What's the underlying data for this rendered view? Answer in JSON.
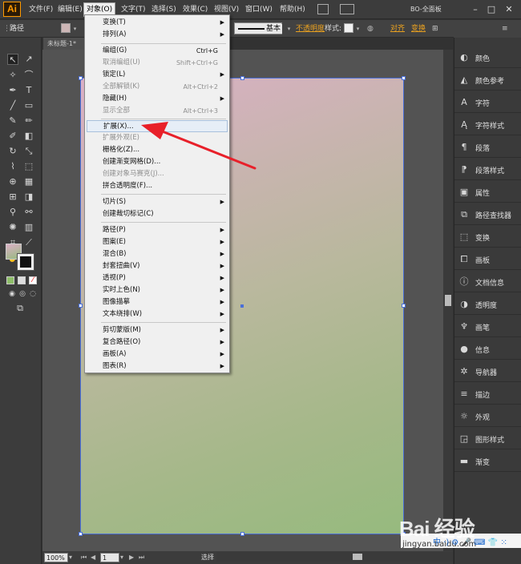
{
  "app": {
    "logo": "Ai"
  },
  "menubar": {
    "items": [
      "文件(F)",
      "编辑(E)",
      "对象(O)",
      "文字(T)",
      "选择(S)",
      "效果(C)",
      "视图(V)",
      "窗口(W)",
      "帮助(H)"
    ],
    "workspace": "BO-全面板",
    "window_buttons": [
      "–",
      "□",
      "✕"
    ]
  },
  "controlbar": {
    "label": "路径",
    "stroke_style": "基本",
    "opacity_label": "不透明度",
    "style_label": "样式:",
    "align_label": "对齐",
    "transform_label": "变换"
  },
  "document": {
    "tab": "未标题-1*"
  },
  "dropdown": {
    "items": [
      {
        "label": "变换(T)",
        "submenu": true
      },
      {
        "label": "排列(A)",
        "submenu": true
      },
      {
        "label": "编组(G)",
        "shortcut": "Ctrl+G"
      },
      {
        "label": "取消编组(U)",
        "shortcut": "Shift+Ctrl+G",
        "disabled": true
      },
      {
        "label": "锁定(L)",
        "submenu": true
      },
      {
        "label": "全部解锁(K)",
        "shortcut": "Alt+Ctrl+2",
        "disabled": true
      },
      {
        "label": "隐藏(H)",
        "submenu": true
      },
      {
        "label": "显示全部",
        "shortcut": "Alt+Ctrl+3",
        "disabled": true
      },
      {
        "label": "扩展(X)...",
        "highlighted": true
      },
      {
        "label": "扩展外观(E)",
        "disabled": true
      },
      {
        "label": "栅格化(Z)..."
      },
      {
        "label": "创建渐变网格(D)..."
      },
      {
        "label": "创建对象马赛克(J)...",
        "disabled": true
      },
      {
        "label": "拼合透明度(F)..."
      },
      {
        "label": "切片(S)",
        "submenu": true
      },
      {
        "label": "创建裁切标记(C)"
      },
      {
        "label": "路径(P)",
        "submenu": true
      },
      {
        "label": "图案(E)",
        "submenu": true
      },
      {
        "label": "混合(B)",
        "submenu": true
      },
      {
        "label": "封套扭曲(V)",
        "submenu": true
      },
      {
        "label": "透视(P)",
        "submenu": true
      },
      {
        "label": "实时上色(N)",
        "submenu": true
      },
      {
        "label": "图像描摹",
        "submenu": true
      },
      {
        "label": "文本绕排(W)",
        "submenu": true
      },
      {
        "label": "剪切蒙版(M)",
        "submenu": true
      },
      {
        "label": "复合路径(O)",
        "submenu": true
      },
      {
        "label": "画板(A)",
        "submenu": true
      },
      {
        "label": "图表(R)",
        "submenu": true
      }
    ]
  },
  "rpanel": {
    "items": [
      "颜色",
      "颜色参考",
      "字符",
      "字符样式",
      "段落",
      "段落样式",
      "属性",
      "路径查找器",
      "变换",
      "画板",
      "文档信息",
      "透明度",
      "画笔",
      "信息",
      "导航器",
      "描边",
      "外观",
      "图形样式",
      "渐变"
    ]
  },
  "statusbar": {
    "zoom": "100%",
    "page": "1",
    "mode": "选择"
  },
  "watermark": {
    "main": "Bai 经验",
    "url": "jingyan.baidu.com",
    "tools": "中 ·) ⚙ 🎤 ⌨ 👕 ⁙"
  },
  "colors": {
    "accent": "#ff9a00",
    "selection": "#4a6fd8",
    "arrow": "#e8202a"
  }
}
